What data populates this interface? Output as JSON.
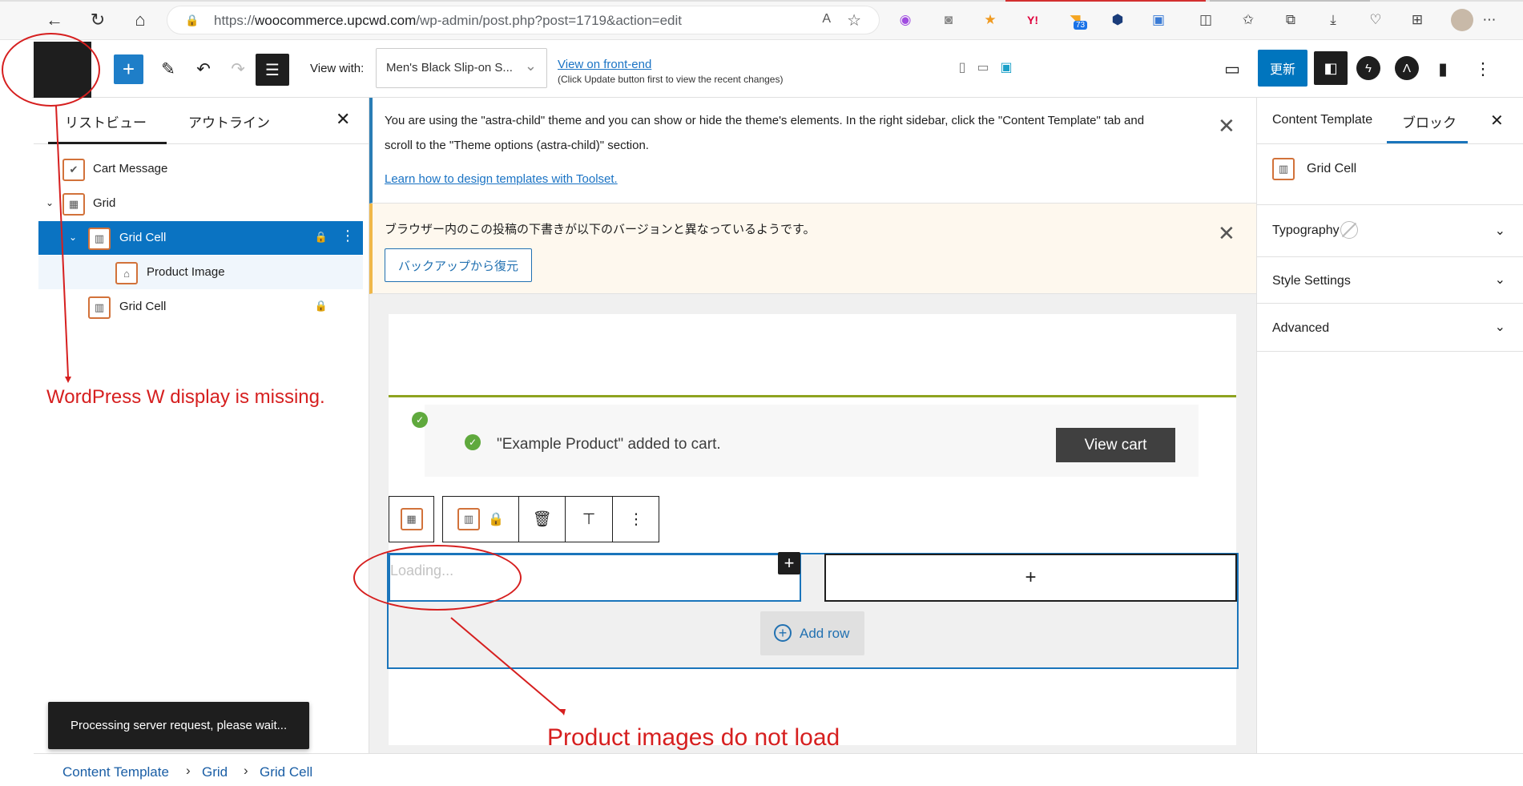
{
  "browser": {
    "url_prefix": "https://",
    "url_host": "woocommerce.upcwd.com",
    "url_path": "/wp-admin/post.php?post=1719&action=edit",
    "read_aloud": "A",
    "ext_badge": "73"
  },
  "header": {
    "view_with_label": "View with:",
    "view_with_value": "Men's Black Slip-on S...",
    "frontend_link": "View on front-end",
    "frontend_note": "(Click Update button first to view the recent changes)",
    "update_button": "更新"
  },
  "left_panel": {
    "tabs": [
      "リストビュー",
      "アウトライン"
    ],
    "tree": [
      {
        "label": "Cart Message"
      },
      {
        "label": "Grid"
      },
      {
        "label": "Grid Cell"
      },
      {
        "label": "Product Image"
      },
      {
        "label": "Grid Cell"
      }
    ]
  },
  "annotations": {
    "logo_missing": "WordPress W display is missing.",
    "images_missing": "Product images do not load"
  },
  "toast": {
    "message": "Processing server request, please wait..."
  },
  "breadcrumb": [
    "Content Template",
    "Grid",
    "Grid Cell"
  ],
  "notices": {
    "theme_line1": "You are using the \"astra-child\" theme and you can show or hide the theme's elements. In the right sidebar, click the \"Content Template\" tab and",
    "theme_line2": "scroll to the \"Theme options (astra-child)\" section.",
    "theme_link": "Learn how to design templates with Toolset.",
    "backup_text": "ブラウザー内のこの投稿の下書きが以下のバージョンと異なっているようです。",
    "backup_button": "バックアップから復元"
  },
  "canvas": {
    "cart_message": "\"Example Product\" added to cart.",
    "view_cart": "View cart",
    "loading": "Loading...",
    "add_row": "Add row"
  },
  "right_panel": {
    "tabs": [
      "Content Template",
      "ブロック"
    ],
    "block_name": "Grid Cell",
    "sections": [
      "Typography",
      "Style Settings",
      "Advanced"
    ]
  },
  "colors": {
    "wp_blue": "#0075be",
    "annotation_red": "#d61f1f",
    "block_icon_orange": "#d2723a",
    "cart_green": "#8ea320"
  }
}
